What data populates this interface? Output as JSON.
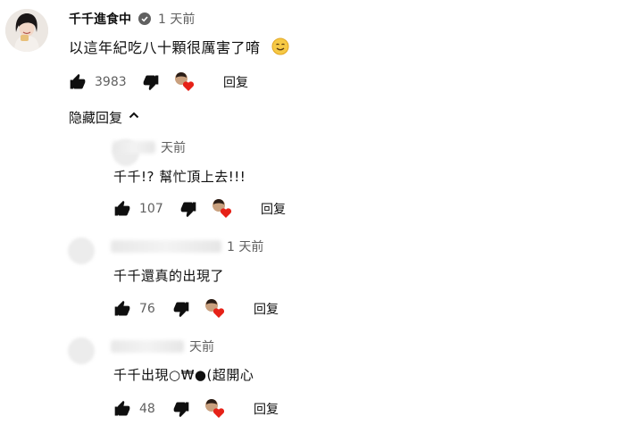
{
  "main_comment": {
    "author": "千千進食中",
    "time": "1 天前",
    "text": "以這年紀吃八十顆很厲害了唷",
    "likes": "3983",
    "reply_label": "回复"
  },
  "hide_replies_label": "隐藏回复",
  "replies": [
    {
      "time": "天前",
      "text": "千千!? 幫忙頂上去!!!",
      "likes": "107",
      "reply_label": "回复"
    },
    {
      "time": "1 天前",
      "text": "千千還真的出現了",
      "likes": "76",
      "reply_label": "回复"
    },
    {
      "time": "天前",
      "text": "千千出現○₩●(超開心",
      "likes": "48",
      "reply_label": "回复"
    }
  ],
  "colors": {
    "secondary_text": "#606060",
    "heart": "#e62117"
  },
  "icons": [
    "verified-icon",
    "smiling-emoji-icon",
    "thumbs-up-icon",
    "thumbs-down-icon",
    "creator-heart-icon",
    "chevron-up-icon"
  ]
}
